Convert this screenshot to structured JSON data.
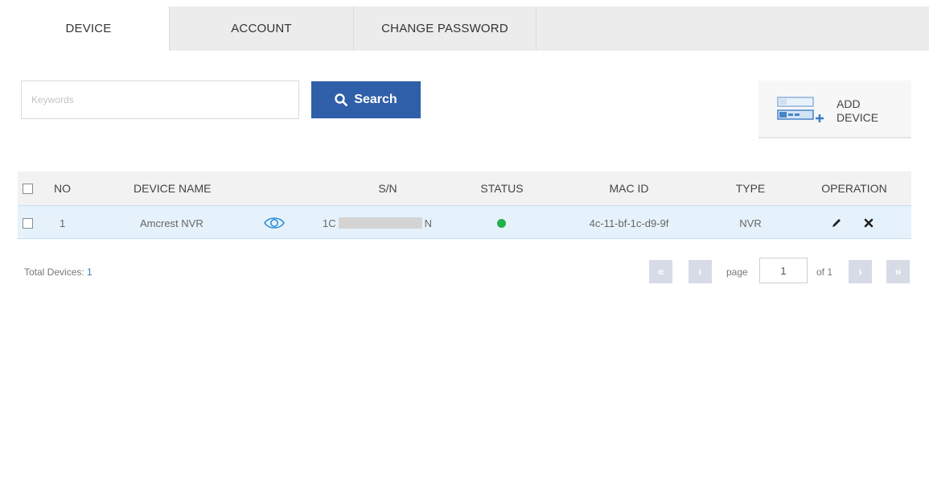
{
  "tabs": [
    {
      "label": "DEVICE",
      "active": true
    },
    {
      "label": "ACCOUNT",
      "active": false
    },
    {
      "label": "CHANGE PASSWORD",
      "active": false
    }
  ],
  "search": {
    "placeholder": "Keywords",
    "value": "",
    "button_label": "Search",
    "button_icon": "search-icon"
  },
  "add_device": {
    "label_line1": "ADD",
    "label_line2": "DEVICE",
    "icon": "add-device-icon"
  },
  "table": {
    "headers": [
      "NO",
      "DEVICE NAME",
      "S/N",
      "STATUS",
      "MAC ID",
      "TYPE",
      "OPERATION"
    ],
    "rows": [
      {
        "no": "1",
        "device_name": "Amcrest NVR",
        "view_icon": "eye-icon",
        "sn_prefix": "1C",
        "sn_suffix": "N",
        "status": "online",
        "status_color": "#22b14c",
        "mac_id": "4c-11-bf-1c-d9-9f",
        "type": "NVR",
        "operations": [
          "edit-icon",
          "delete-icon"
        ]
      }
    ]
  },
  "footer": {
    "total_label": "Total Devices:",
    "total_value": "1",
    "page_label": "page",
    "page_value": "1",
    "of_label": "of 1"
  },
  "colors": {
    "accent": "#2f5fa8",
    "row_highlight": "#e6f2fb",
    "status_online": "#22b14c"
  }
}
